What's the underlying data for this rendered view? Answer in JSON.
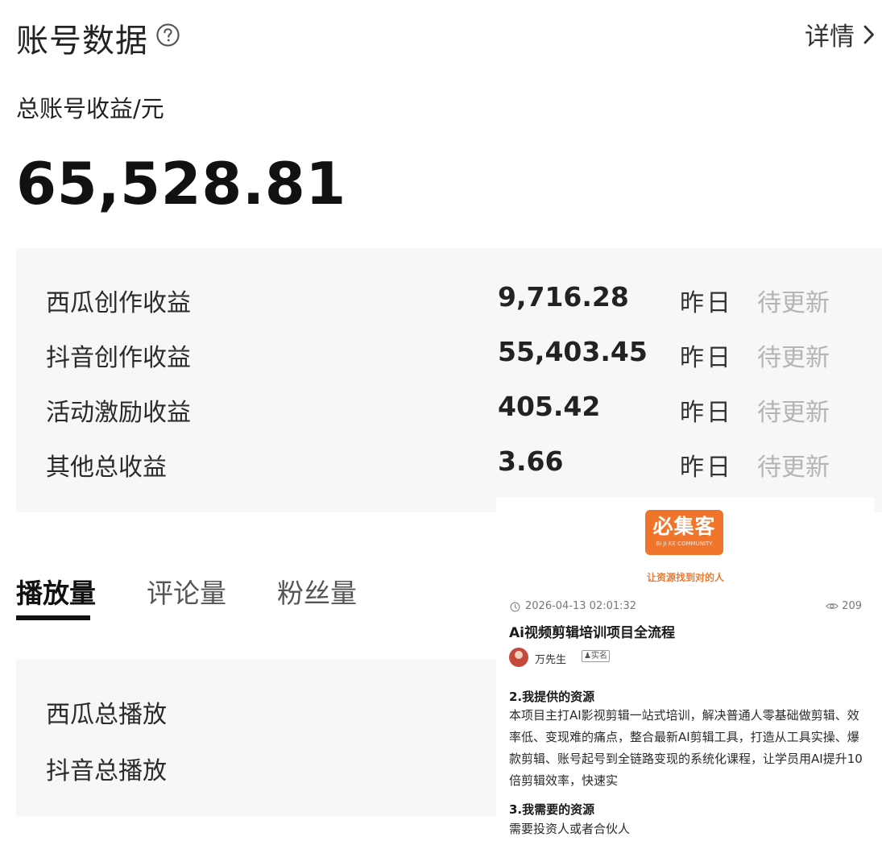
{
  "header": {
    "title": "账号数据",
    "help_icon": "question-circle-icon",
    "details_label": "详情",
    "details_icon": "chevron-right-icon"
  },
  "total": {
    "label": "总账号收益/元",
    "value": "65,528.81"
  },
  "revenue_rows": [
    {
      "label": "西瓜创作收益",
      "value": "9,716.28",
      "day": "昨日",
      "status": "待更新"
    },
    {
      "label": "抖音创作收益",
      "value": "55,403.45",
      "day": "昨日",
      "status": "待更新"
    },
    {
      "label": "活动激励收益",
      "value": "405.42",
      "day": "昨日",
      "status": "待更新"
    },
    {
      "label": "其他总收益",
      "value": "3.66",
      "day": "昨日",
      "status": "待更新"
    }
  ],
  "tabs": [
    {
      "label": "播放量",
      "active": true
    },
    {
      "label": "评论量",
      "active": false
    },
    {
      "label": "粉丝量",
      "active": false
    }
  ],
  "plays": [
    {
      "label": "西瓜总播放"
    },
    {
      "label": "抖音总播放"
    }
  ],
  "card": {
    "logo_text": "必集客",
    "logo_sub": "BI JI KE COMMUNITY",
    "slogan": "让资源找到对的人",
    "date": "2026-04-13 02:01:32",
    "views": "209",
    "title": "Ai视频剪辑培训项目全流程",
    "author": "万先生",
    "badge": "实名",
    "section2_title": "2.我提供的资源",
    "section2_body": "本项目主打AI影视剪辑一站式培训，解决普通人零基础做剪辑、效率低、变现难的痛点，整合最新AI剪辑工具，打造从工具实操、爆款剪辑、账号起号到全链路变现的系统化课程，让学员用AI提升10倍剪辑效率，快速实",
    "section3_title": "3.我需要的资源",
    "section3_body": "需要投资人或者合伙人"
  },
  "colors": {
    "panel_bg": "#f7f7f7",
    "muted_text": "#b4b4b4",
    "brand_orange": "#f0742a",
    "indicator": "#111111"
  }
}
